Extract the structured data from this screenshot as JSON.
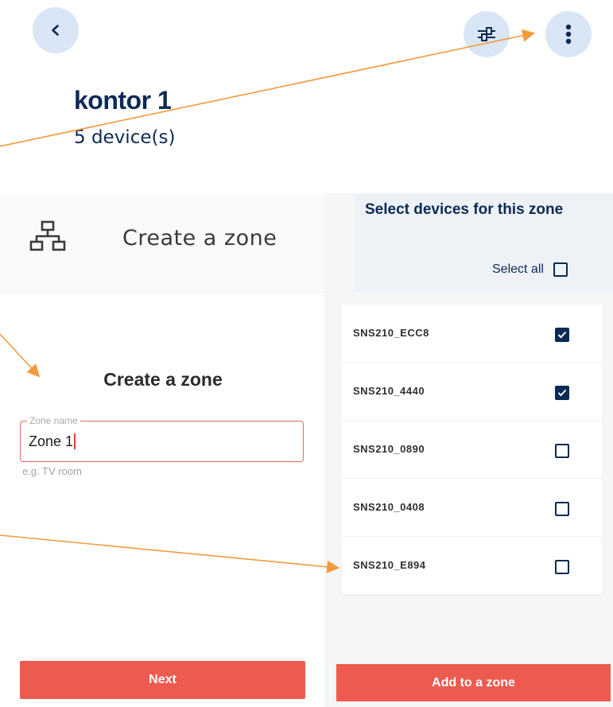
{
  "header": {
    "back_icon": "chevron-left-icon",
    "filter_icon": "sliders-icon",
    "more_icon": "more-vertical-icon",
    "title": "kontor 1",
    "subtitle": "5 device(s)"
  },
  "left_panel": {
    "header_icon": "zone-hierarchy-icon",
    "header_label": "Create a zone",
    "form_heading": "Create a zone",
    "zone_name_legend": "Zone name",
    "zone_name_value": "Zone 1",
    "zone_name_hint": "e.g. TV room",
    "next_label": "Next"
  },
  "right_panel": {
    "heading": "Select devices for this zone",
    "select_all_label": "Select all",
    "select_all_checked": false,
    "devices": [
      {
        "name": "SNS210_ECC8",
        "checked": true
      },
      {
        "name": "SNS210_4440",
        "checked": true
      },
      {
        "name": "SNS210_0890",
        "checked": false
      },
      {
        "name": "SNS210_0408",
        "checked": false
      },
      {
        "name": "SNS210_E894",
        "checked": false
      }
    ],
    "add_label": "Add to a zone"
  },
  "colors": {
    "brand_navy": "#0b2a54",
    "accent_red": "#ed5b50",
    "icon_circle": "#d9e6f5",
    "annotation_arrow": "#f29a3b"
  }
}
